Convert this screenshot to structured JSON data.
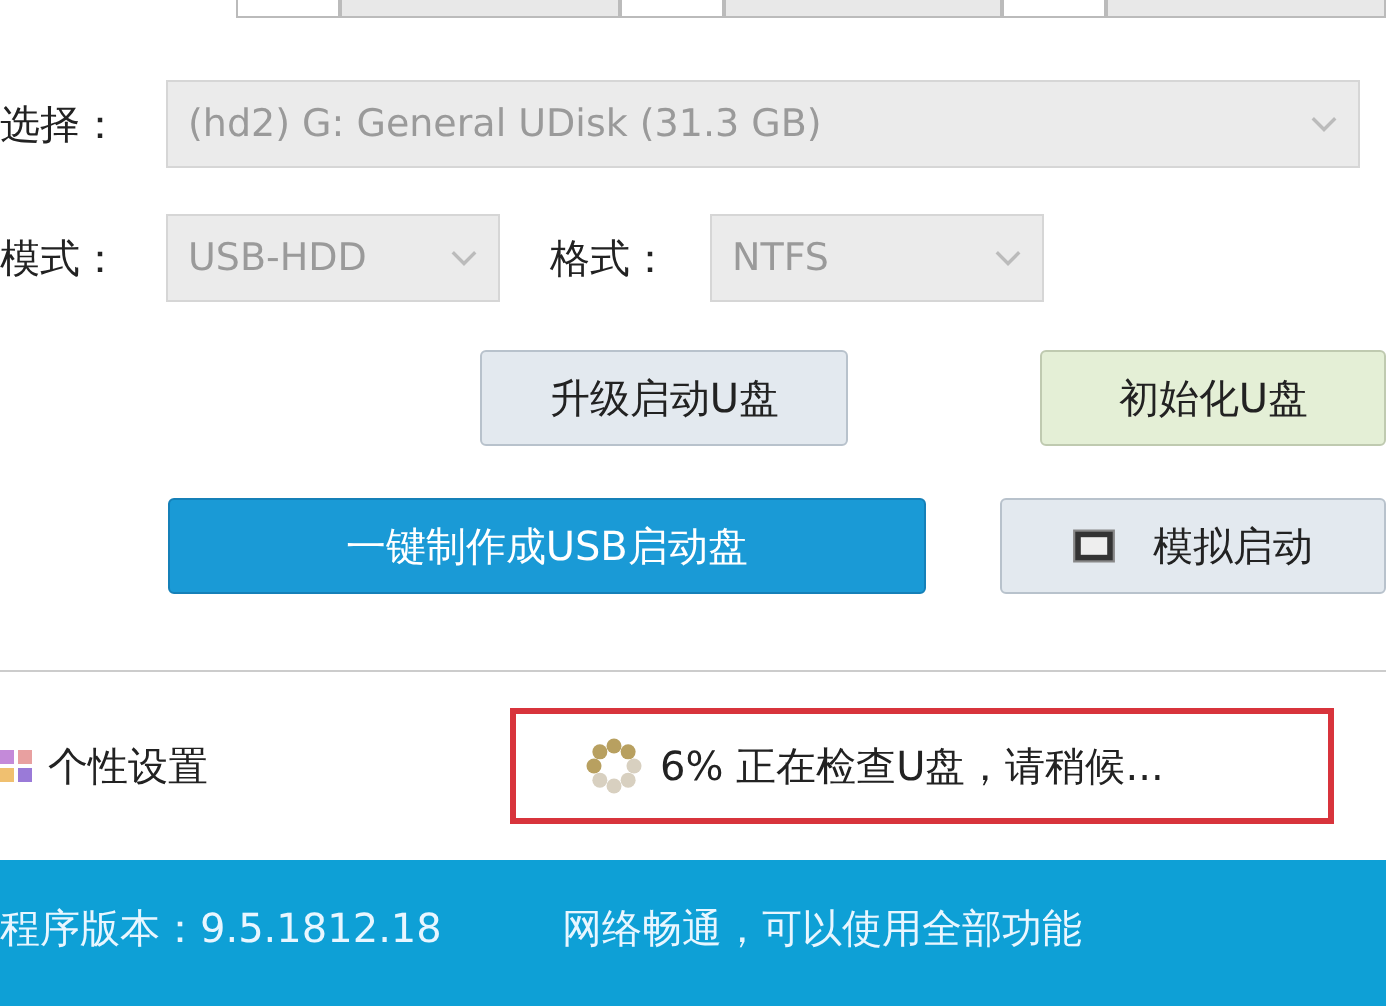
{
  "tabs": [
    {
      "selected": false
    },
    {
      "selected": false
    },
    {
      "selected": false
    },
    {
      "selected": false
    },
    {
      "selected": false
    },
    {
      "selected": false
    }
  ],
  "device": {
    "label": "选择：",
    "value": "(hd2) G: General UDisk (31.3 GB)",
    "disabled": true
  },
  "mode": {
    "label": "模式：",
    "value": "USB-HDD",
    "disabled": true
  },
  "format": {
    "label": "格式：",
    "value": "NTFS",
    "disabled": true
  },
  "buttons": [
    {
      "label": "升级启动U盘",
      "kind": "plain"
    },
    {
      "label": "初始化U盘",
      "kind": "green"
    },
    {
      "label": "一键制作成USB启动盘",
      "kind": "primary"
    },
    {
      "label": "模拟启动",
      "kind": "icon"
    }
  ],
  "settings": {
    "label": "个性设置"
  },
  "progress": {
    "text": "6% 正在检查U盘，请稍候..."
  },
  "status_bar": {
    "version": "程序版本：9.5.1812.18",
    "network": "网络畅通，可以使用全部功能"
  }
}
